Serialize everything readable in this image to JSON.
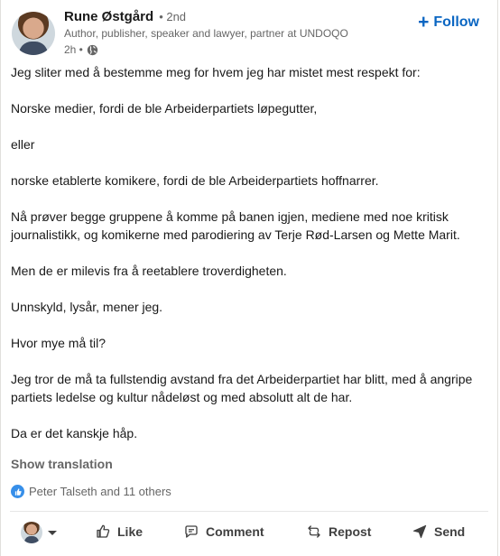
{
  "author": {
    "name": "Rune Østgård",
    "degree": "• 2nd",
    "headline": "Author, publisher, speaker and lawyer, partner at UNDOQO",
    "time": "2h •"
  },
  "follow_label": "Follow",
  "post_paragraphs": [
    "Jeg sliter med å bestemme meg for hvem jeg har mistet mest respekt for:",
    "Norske medier, fordi de ble Arbeiderpartiets løpegutter,",
    "eller",
    "norske etablerte komikere, fordi de ble Arbeiderpartiets hoffnarrer.",
    "Nå prøver begge gruppene å komme på banen igjen, mediene med noe kritisk journalistikk, og komikerne med parodiering av Terje Rød-Larsen og Mette Marit.",
    "Men de er milevis fra å reetablere troverdigheten.",
    "Unnskyld, lysår, mener jeg.",
    "Hvor mye må til?",
    "Jeg tror de må ta fullstendig avstand fra det Arbeiderpartiet har blitt, med å angripe partiets ledelse og kultur nådeløst og med absolutt alt de har.",
    "Da er det kanskje håp."
  ],
  "show_translation": "Show translation",
  "reactions_text": "Peter Talseth and 11 others",
  "actions": {
    "like": "Like",
    "comment": "Comment",
    "repost": "Repost",
    "send": "Send"
  },
  "colors": {
    "accent": "#0a66c2",
    "like_blue": "#378fe9",
    "text": "#191919",
    "muted": "#666666"
  },
  "icons": [
    "globe-icon",
    "plus-icon",
    "like-icon",
    "comment-icon",
    "repost-icon",
    "send-icon",
    "caret-down-icon"
  ]
}
